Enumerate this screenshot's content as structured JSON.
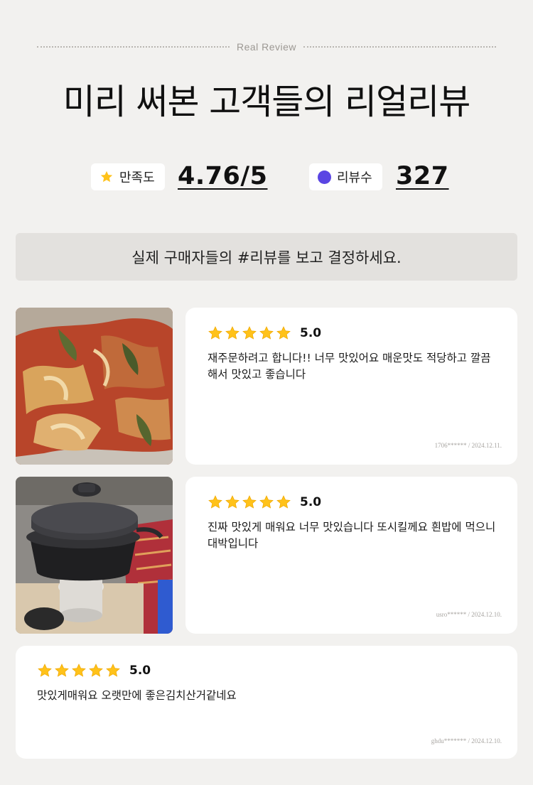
{
  "header": {
    "eyebrow": "Real Review",
    "title": "미리 써본 고객들의 리얼리뷰"
  },
  "stats": {
    "satisfaction": {
      "label": "만족도",
      "value": "4.76/5",
      "icon": "star-icon"
    },
    "review_count": {
      "label": "리뷰수",
      "value": "327",
      "icon": "dot-icon"
    }
  },
  "banner": {
    "text": "실제 구매자들의 #리뷰를 보고 결정하세요."
  },
  "colors": {
    "star": "#ffc21a",
    "accent_purple": "#5a45e3",
    "background": "#f2f1ef"
  },
  "reviews": [
    {
      "rating": 5,
      "score": "5.0",
      "text": "재주문하려고 합니다!! 너무 맛있어요 매운맛도 적당하고 깔끔해서 맛있고 좋습니다",
      "meta": "1706****** / 2024.12.11.",
      "image": "kimchi-photo"
    },
    {
      "rating": 5,
      "score": "5.0",
      "text": "진짜 맛있게 매워요 너무 맛있습니다 또시킬께요 흰밥에 먹으니 대박입니다",
      "meta": "usro****** / 2024.12.10.",
      "image": "pot-on-stove-photo"
    },
    {
      "rating": 5,
      "score": "5.0",
      "text": "맛있게매워요 오랫만에 좋은김치산거같네요",
      "meta": "ghdu******* / 2024.12.10."
    }
  ]
}
